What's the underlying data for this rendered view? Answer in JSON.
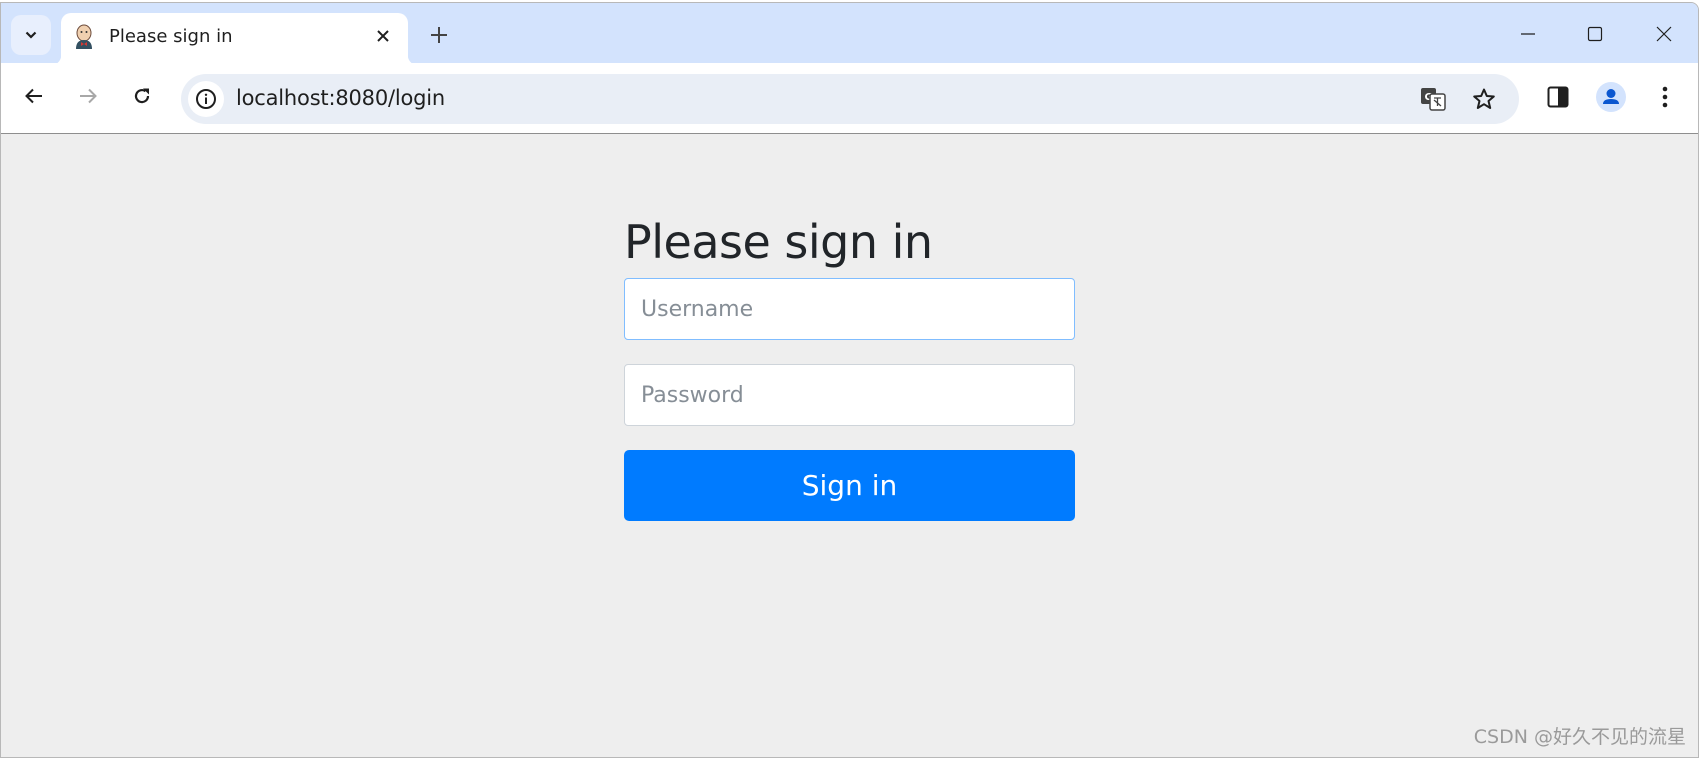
{
  "browser": {
    "tab": {
      "title": "Please sign in",
      "favicon": "jenkins-butler-icon"
    },
    "url": "localhost:8080/login",
    "icons": {
      "tab_search": "chevron-down-icon",
      "tab_close": "close-icon",
      "new_tab": "plus-icon",
      "minimize": "minimize-icon",
      "maximize": "maximize-icon",
      "close": "close-icon",
      "back": "arrow-left-icon",
      "forward": "arrow-right-icon",
      "reload": "reload-icon",
      "site_info": "info-icon",
      "translate": "translate-icon",
      "bookmark": "star-icon",
      "side_panel": "side-panel-icon",
      "profile": "profile-icon",
      "menu": "kebab-menu-icon"
    }
  },
  "page": {
    "heading": "Please sign in",
    "username": {
      "placeholder": "Username",
      "value": ""
    },
    "password": {
      "placeholder": "Password",
      "value": ""
    },
    "submit_label": "Sign in",
    "accent_color": "#007bff"
  },
  "watermark": "CSDN @好久不见的流星"
}
